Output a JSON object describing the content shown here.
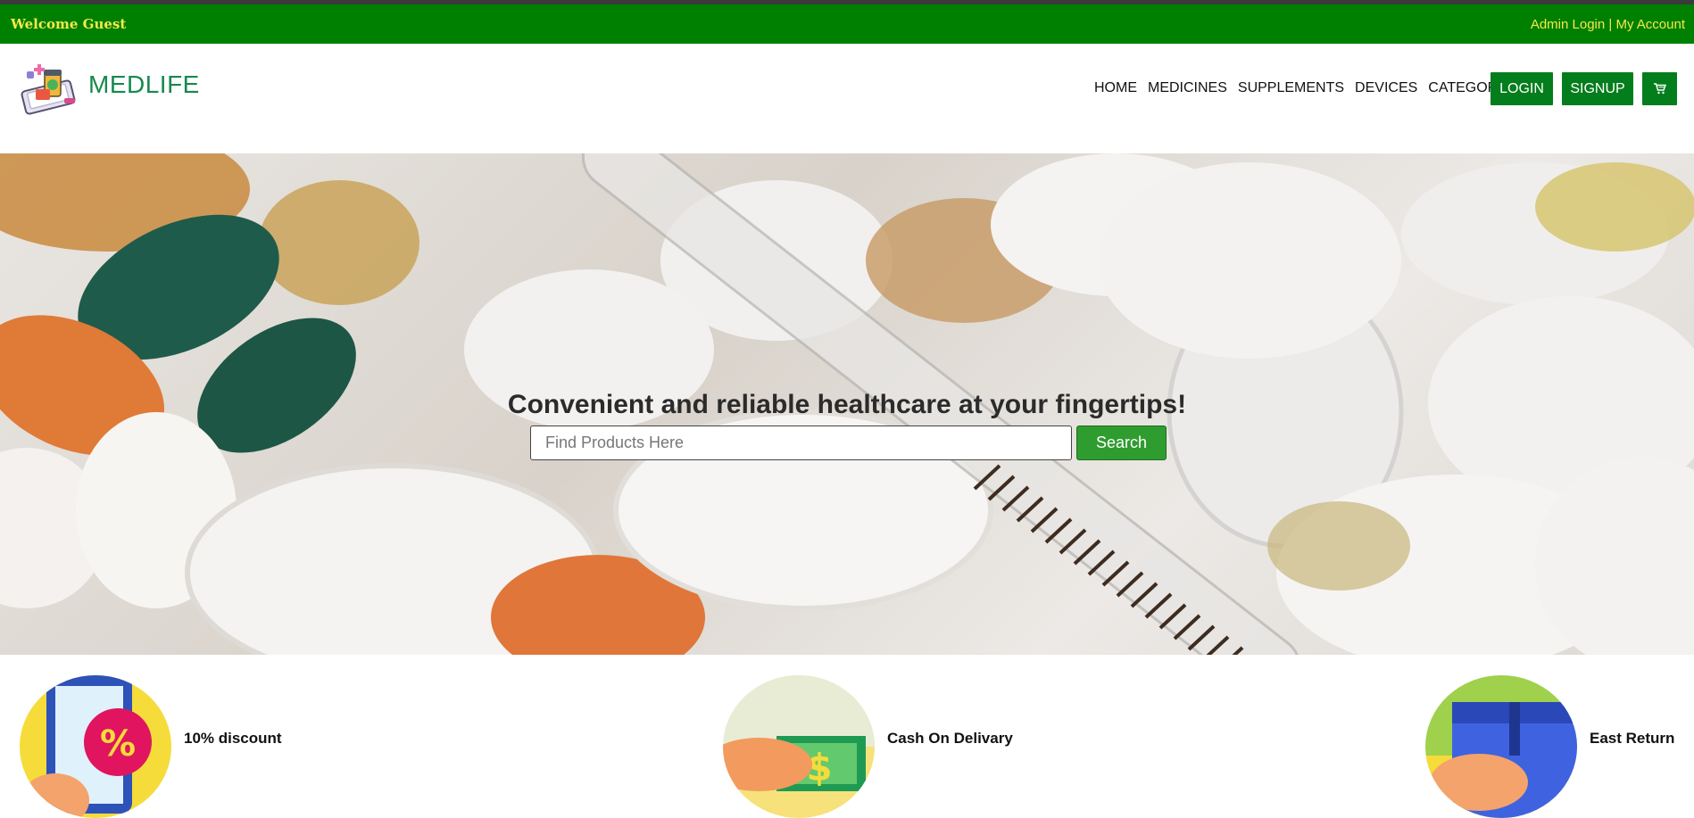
{
  "topbar": {
    "welcome": "Welcome Guest",
    "admin_login": "Admin Login",
    "separator": " | ",
    "my_account": "My Account"
  },
  "header": {
    "brand": "MEDLIFE",
    "nav": [
      "HOME",
      "MEDICINES",
      "SUPPLEMENTS",
      "DEVICES",
      "CATEGORIES"
    ],
    "login": "LOGIN",
    "signup": "SIGNUP",
    "cart_icon": "cart-icon"
  },
  "hero": {
    "title": "Convenient and reliable healthcare at your fingertips!",
    "search_placeholder": "Find Products Here",
    "search_button": "Search"
  },
  "features": [
    {
      "label": "10% discount",
      "icon": "discount-phone-icon"
    },
    {
      "label": "Cash On Delivary",
      "icon": "cash-hand-icon"
    },
    {
      "label": "East Return",
      "icon": "return-box-icon"
    }
  ],
  "colors": {
    "topbar_bg": "#008000",
    "topbar_text": "#f5e94b",
    "brand": "#17894f",
    "button": "#047d1c",
    "search_button": "#2f9c2f"
  }
}
